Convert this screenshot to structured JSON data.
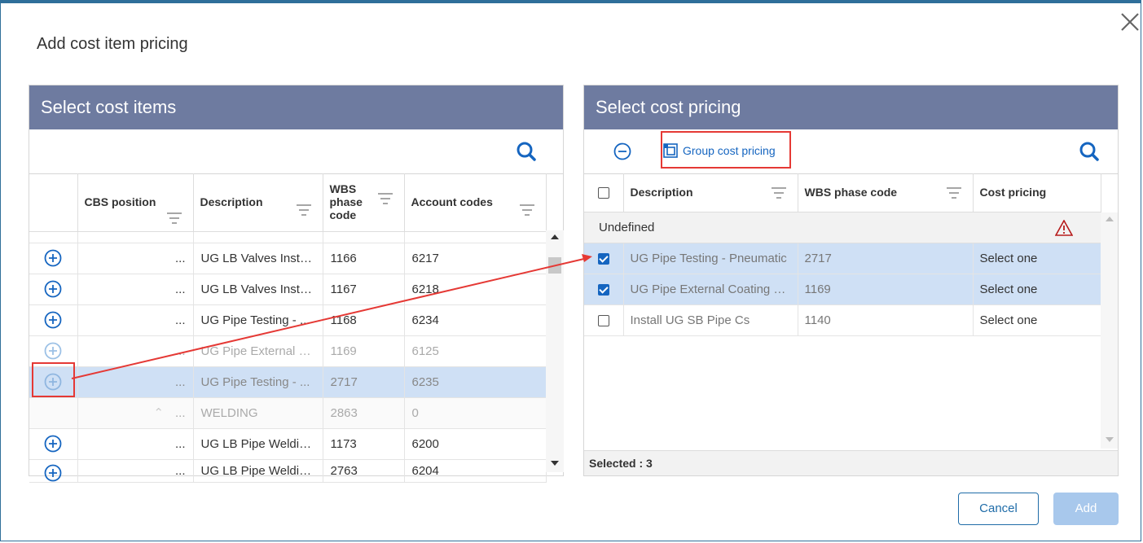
{
  "dialog": {
    "title": "Add cost item pricing"
  },
  "left": {
    "header": "Select cost items",
    "columns": [
      "CBS position",
      "Description",
      "WBS phase code",
      "Account codes"
    ],
    "rows": [
      {
        "cbs": "...",
        "desc": "UG LB Valves Insta...",
        "wbs": "1166",
        "acct": "6217",
        "state": "normal"
      },
      {
        "cbs": "...",
        "desc": "UG LB Valves Insta...",
        "wbs": "1167",
        "acct": "6218",
        "state": "normal"
      },
      {
        "cbs": "...",
        "desc": "UG Pipe Testing - ...",
        "wbs": "1168",
        "acct": "6234",
        "state": "normal"
      },
      {
        "cbs": "...",
        "desc": "UG Pipe External C...",
        "wbs": "1169",
        "acct": "6125",
        "state": "dim"
      },
      {
        "cbs": "...",
        "desc": "UG Pipe Testing - ...",
        "wbs": "2717",
        "acct": "6235",
        "state": "sel"
      },
      {
        "cbs": "...",
        "desc": "WELDING",
        "wbs": "2863",
        "acct": "0",
        "state": "group"
      },
      {
        "cbs": "...",
        "desc": "UG LB Pipe Weldin...",
        "wbs": "1173",
        "acct": "6200",
        "state": "normal"
      },
      {
        "cbs": "...",
        "desc": "UG LB Pipe Weldin...",
        "wbs": "2763",
        "acct": "6204",
        "state": "normal"
      }
    ]
  },
  "right": {
    "header": "Select cost pricing",
    "group_label": "Group cost pricing",
    "columns": [
      "Description",
      "WBS phase code",
      "Cost pricing"
    ],
    "category": "Undefined",
    "rows": [
      {
        "desc": "UG Pipe Testing - Pneumatic",
        "wbs": "2717",
        "pricing": "Select one",
        "checked": true
      },
      {
        "desc": "UG Pipe External Coating W...",
        "wbs": "1169",
        "pricing": "Select one",
        "checked": true
      },
      {
        "desc": "Install UG SB Pipe Cs",
        "wbs": "1140",
        "pricing": "Select one",
        "checked": false
      }
    ],
    "selected_label": "Selected : 3"
  },
  "buttons": {
    "cancel": "Cancel",
    "add": "Add"
  },
  "colors": {
    "header_bg": "#6e7ba0",
    "accent": "#1565c0",
    "selected_row": "#cfe0f5",
    "highlight": "#e53935"
  }
}
